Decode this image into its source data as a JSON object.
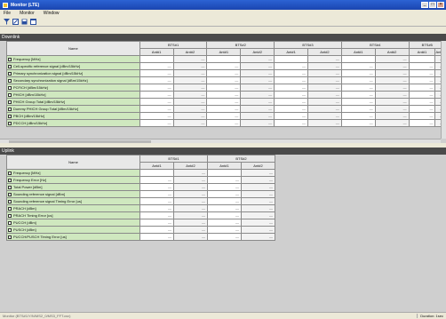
{
  "window": {
    "title": "Monitor (LTE)",
    "min": "_",
    "max": "□",
    "close": "×"
  },
  "menu": [
    "File",
    "Monitor",
    "Window"
  ],
  "toolbar_icons": [
    "filter-icon",
    "edit-icon",
    "save-icon",
    "window-icon"
  ],
  "downlink": {
    "header": "Downlink",
    "name_header": "Name",
    "groups": [
      "BTS#1",
      "BTS#2",
      "BTS#3",
      "BTS#4",
      "BTS#5"
    ],
    "sub": [
      "Ant#1",
      "Ant#2"
    ],
    "rows": [
      {
        "name": "Frequency [MHz]",
        "vals": [
          "",
          "—",
          "",
          "—",
          "",
          "—",
          "",
          "—",
          "",
          "—"
        ]
      },
      {
        "name": "Cell-specific reference signal [dBm/15kHz]",
        "vals": [
          "—",
          "—",
          "—",
          "—",
          "—",
          "—",
          "—",
          "—",
          "—",
          "—"
        ]
      },
      {
        "name": "Primary synchronization signal [dBm/15kHz]",
        "vals": [
          "—",
          "—",
          "—",
          "—",
          "—",
          "—",
          "—",
          "—",
          "—",
          "—"
        ]
      },
      {
        "name": "Secondary synchronization signal [dBm/15kHz]",
        "vals": [
          "—",
          "—",
          "—",
          "—",
          "—",
          "—",
          "—",
          "—",
          "—",
          "—"
        ]
      },
      {
        "name": "PCFICH [dBm/15kHz]",
        "vals": [
          "—",
          "—",
          "—",
          "—",
          "—",
          "—",
          "—",
          "—",
          "—",
          "—"
        ]
      },
      {
        "name": "PHICH [dBm/15kHz]",
        "vals": [
          "—",
          "—",
          "—",
          "—",
          "—",
          "—",
          "—",
          "—",
          "—",
          "—"
        ]
      },
      {
        "name": "PHICH Group Total [dBm/15kHz]",
        "vals": [
          "—",
          "—",
          "—",
          "—",
          "—",
          "—",
          "—",
          "—",
          "—",
          "—"
        ]
      },
      {
        "name": "Dummy PHICH Group Total [dBm/15kHz]",
        "vals": [
          "—",
          "—",
          "—",
          "—",
          "—",
          "—",
          "—",
          "—",
          "—",
          "—"
        ]
      },
      {
        "name": "PBCH [dBm/15kHz]",
        "vals": [
          "—",
          "—",
          "—",
          "—",
          "—",
          "—",
          "—",
          "—",
          "—",
          "—"
        ]
      },
      {
        "name": "PDCCH [dBm/15kHz]",
        "vals": [
          "—",
          "—",
          "—",
          "—",
          "—",
          "—",
          "—",
          "—",
          "—",
          "—"
        ]
      }
    ]
  },
  "uplink": {
    "header": "Uplink",
    "name_header": "Name",
    "groups": [
      "BTS#1",
      "BTS#2"
    ],
    "sub": [
      "Ant#1",
      "Ant#2"
    ],
    "rows": [
      {
        "name": "Frequency [MHz]",
        "vals": [
          "",
          "—",
          "",
          "—"
        ]
      },
      {
        "name": "Frequency Error [Hz]",
        "vals": [
          "—",
          "—",
          "—",
          "—"
        ]
      },
      {
        "name": "Total Power [dBm]",
        "vals": [
          "—",
          "—",
          "—",
          "—"
        ]
      },
      {
        "name": "Sounding reference signal [dBm]",
        "vals": [
          "—",
          "—",
          "—",
          "—"
        ]
      },
      {
        "name": "Sounding reference signal Timing Error [us]",
        "vals": [
          "—",
          "—",
          "—",
          "—"
        ]
      },
      {
        "name": "PRACH [dBm]",
        "vals": [
          "—",
          "—",
          "—",
          "—"
        ]
      },
      {
        "name": "PRACH Timing Error [us]",
        "vals": [
          "—",
          "—",
          "—",
          "—"
        ]
      },
      {
        "name": "PUCCH [dBm]",
        "vals": [
          "—",
          "—",
          "—",
          "—"
        ]
      },
      {
        "name": "PUSCH [dBm]",
        "vals": [
          "—",
          "—",
          "—",
          "—"
        ]
      },
      {
        "name": "PUCCH/PUSCH Timing Error [us]",
        "vals": [
          "—",
          "—",
          "—",
          "—"
        ]
      }
    ]
  },
  "status": {
    "left": "Monitor (BTS#1/Y/N/MS2_0/MS3_FFT.csv)",
    "right": "Duration: 1sec"
  }
}
